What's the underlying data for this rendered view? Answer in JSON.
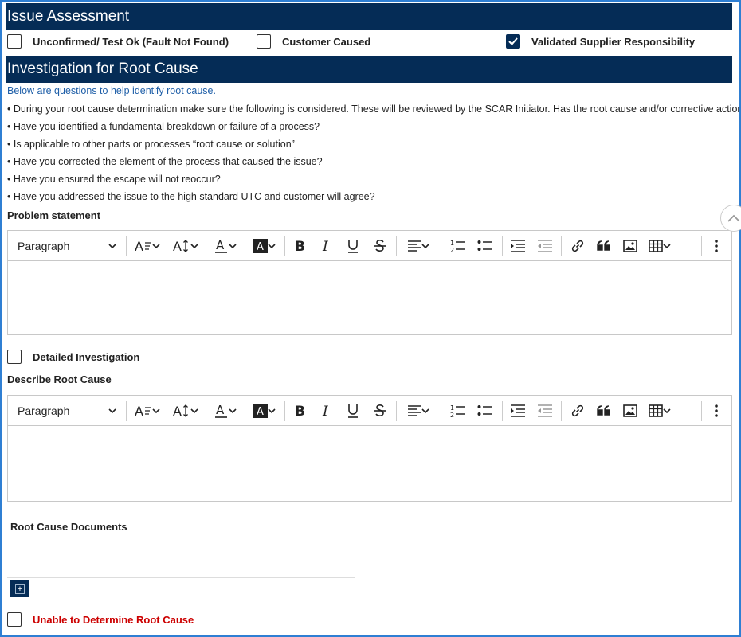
{
  "issue_assessment": {
    "title": "Issue Assessment",
    "options": [
      {
        "label": "Unconfirmed/ Test Ok (Fault Not Found)",
        "checked": false
      },
      {
        "label": "Customer Caused",
        "checked": false
      },
      {
        "label": "Validated Supplier Responsibility",
        "checked": true
      }
    ]
  },
  "investigation": {
    "title": "Investigation for Root Cause",
    "intro": "Below are questions to help identify root cause.",
    "bullets": [
      "• During your root cause determination make sure the following is considered. These will be reviewed by the SCAR Initiator. Has the root cause and/or corrective action?",
      "• Have you identified a fundamental breakdown or failure of a process?",
      "• Is applicable to other parts or processes “root cause or solution”",
      "• Have you corrected the element of the process that caused the issue?",
      "• Have you ensured the escape will not reoccur?",
      "• Have you addressed the issue to the high standard UTC and customer will agree?"
    ]
  },
  "problem_statement": {
    "label": "Problem statement",
    "paragraph_style": "Paragraph"
  },
  "detailed_investigation": {
    "label": "Detailed Investigation",
    "checked": false
  },
  "root_cause": {
    "label": "Describe Root Cause",
    "paragraph_style": "Paragraph"
  },
  "documents": {
    "label": "Root Cause Documents",
    "add_label": "+"
  },
  "unable_to_determine": {
    "label": "Unable to Determine Root Cause",
    "checked": false
  },
  "colors": {
    "header_bg": "#052c56",
    "accent_blue": "#1f5fa8",
    "warning_red": "#cc0000",
    "frame_border": "#2f7fd3"
  },
  "icons": [
    "chevron-down-icon",
    "font-family-icon",
    "font-size-icon",
    "font-color-icon",
    "highlight-icon",
    "bold-icon",
    "italic-icon",
    "underline-icon",
    "strikethrough-icon",
    "align-icon",
    "numbered-list-icon",
    "bulleted-list-icon",
    "indent-icon",
    "outdent-icon",
    "link-icon",
    "blockquote-icon",
    "image-icon",
    "table-icon",
    "more-icon",
    "chevron-up-icon",
    "checkmark-icon"
  ]
}
